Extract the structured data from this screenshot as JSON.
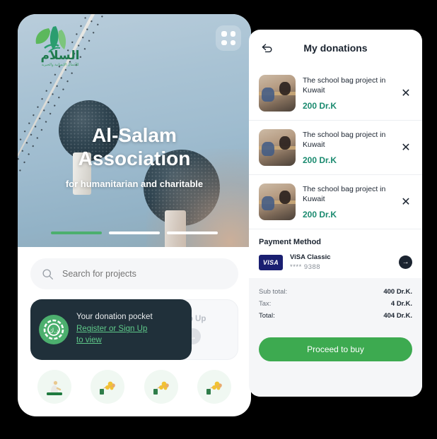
{
  "left_panel": {
    "logo_alt": "Al-Salam Association logo",
    "grid_menu": "grid-menu",
    "hero": {
      "title_line1": "Al-Salam",
      "title_line2": "Association",
      "subtitle": "for humanitarian and charitable",
      "carousel": {
        "count": 3,
        "active_index": 0,
        "active_color": "#4caf6e",
        "inactive_color": "#ffffff"
      }
    },
    "search": {
      "placeholder": "Search for projects",
      "value": ""
    },
    "pocket": {
      "title": "Your donation pocket",
      "link_line1": "Register or Sign Up",
      "link_line2": "to view",
      "top_up_label": "Top Up",
      "card_color": "#20303a",
      "accent_color": "#4caf6e"
    },
    "categories": [
      {
        "name": "praying-person-icon"
      },
      {
        "name": "hand-coins-icon"
      },
      {
        "name": "hand-coins-icon"
      },
      {
        "name": "hand-coins-icon"
      }
    ]
  },
  "right_panel": {
    "back_icon": "back-arrow-icon",
    "title": "My donations",
    "donations": [
      {
        "name": "The school bag project in Kuwait",
        "amount": "200 Dr.K"
      },
      {
        "name": "The school bag project in Kuwait",
        "amount": "200 Dr.K"
      },
      {
        "name": "The school bag project in Kuwait",
        "amount": "200 Dr.K"
      }
    ],
    "payment": {
      "section_title": "Payment Method",
      "brand": "VISA",
      "card_name": "ViSA Classic",
      "card_number": "**** 9388",
      "arrow_icon": "arrow-right-icon"
    },
    "totals": [
      {
        "label": "Sub total:",
        "value": "400 Dr.K."
      },
      {
        "label": "Tax:",
        "value": "4 Dr.K."
      },
      {
        "label": "Total:",
        "value": "404 Dr.K."
      }
    ],
    "buy_button": "Proceed to buy",
    "buy_color": "#3daa50",
    "amount_color": "#1a8a6f"
  }
}
